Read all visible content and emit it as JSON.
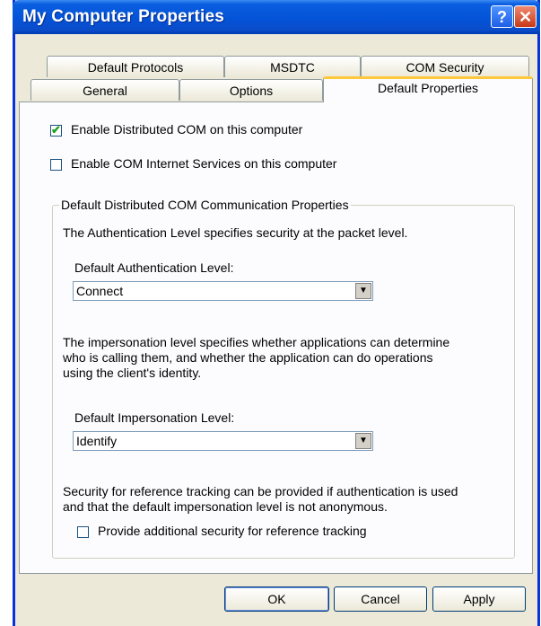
{
  "window": {
    "title": "My Computer Properties",
    "help_icon": "?",
    "close_icon": "✕"
  },
  "tabs": [
    {
      "label": "Default Protocols"
    },
    {
      "label": "MSDTC"
    },
    {
      "label": "COM Security"
    },
    {
      "label": "General"
    },
    {
      "label": "Options"
    },
    {
      "label": "Default Properties",
      "selected": true
    }
  ],
  "options": {
    "enable_dcom": {
      "label": "Enable Distributed COM on this computer",
      "checked": true
    },
    "enable_cis": {
      "label": "Enable COM Internet Services on this computer",
      "checked": false
    }
  },
  "group": {
    "legend": "Default Distributed COM Communication Properties",
    "auth_desc": "The Authentication Level specifies security at the packet level.",
    "auth_label": "Default Authentication Level:",
    "auth_value": "Connect",
    "imp_desc": [
      "The impersonation level specifies whether applications can determine",
      "who is calling them, and whether the application can do operations",
      "using the client's identity."
    ],
    "imp_label": "Default Impersonation Level:",
    "imp_value": "Identify",
    "ref_desc": [
      "Security for reference tracking can be provided if authentication is used",
      "and that the default impersonation level is not anonymous."
    ],
    "ref_check": {
      "label": "Provide additional security for reference tracking",
      "checked": false
    }
  },
  "buttons": {
    "ok": "OK",
    "cancel": "Cancel",
    "apply": "Apply"
  },
  "colors": {
    "titlebar": "#0453d8",
    "face": "#ece9d8",
    "tab_highlight": "#ffc83c",
    "check": "#21a121"
  }
}
